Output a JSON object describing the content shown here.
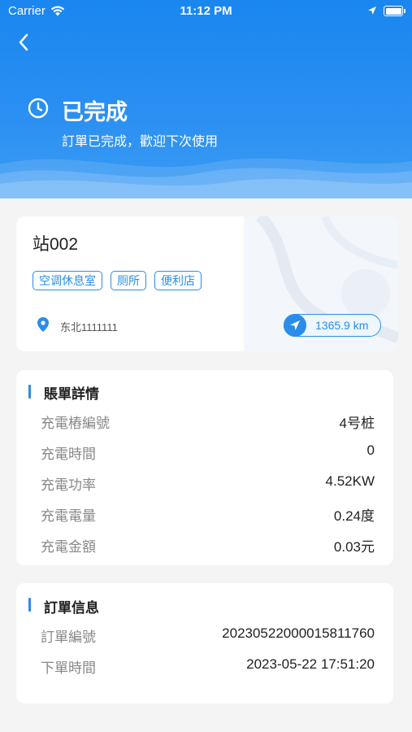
{
  "status_bar": {
    "carrier": "Carrier",
    "time": "11:12 PM"
  },
  "header": {
    "title": "已完成",
    "subtitle": "訂單已完成，歡迎下次使用",
    "accent_color": "#1a86f0"
  },
  "station": {
    "name": "站002",
    "tags": [
      "空调休息室",
      "厕所",
      "便利店"
    ],
    "address": "东北1111111",
    "distance": "1365.9 km"
  },
  "bill": {
    "title": "賬單詳情",
    "rows": [
      {
        "label": "充電樁編號",
        "value": "4号桩"
      },
      {
        "label": "充電時間",
        "value": "0"
      },
      {
        "label": "充電功率",
        "value": "4.52KW"
      },
      {
        "label": "充電電量",
        "value": "0.24度"
      },
      {
        "label": "充電金額",
        "value": "0.03元"
      }
    ]
  },
  "order": {
    "title": "訂單信息",
    "rows": [
      {
        "label": "訂單編號",
        "value": "20230522000015811760"
      },
      {
        "label": "下單時間",
        "value": "2023-05-22 17:51:20"
      }
    ]
  }
}
